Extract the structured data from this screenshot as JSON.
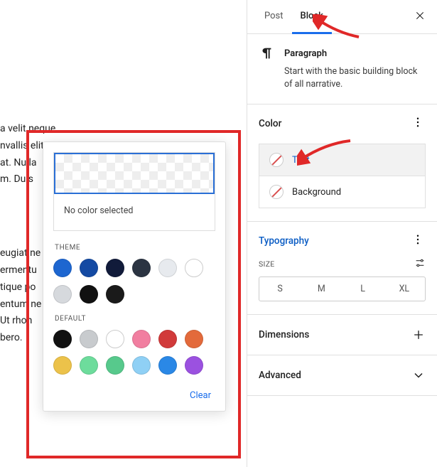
{
  "tabs": {
    "post": "Post",
    "block": "Block"
  },
  "block_intro": {
    "title": "Paragraph",
    "desc": "Start with the basic building block of all narrative."
  },
  "color_panel": {
    "title": "Color",
    "text_label": "Text",
    "background_label": "Background"
  },
  "typography_panel": {
    "title": "Typography",
    "size_label": "SIZE",
    "sizes": {
      "s": "S",
      "m": "M",
      "l": "L",
      "xl": "XL"
    }
  },
  "dimensions_label": "Dimensions",
  "advanced_label": "Advanced",
  "editor_text": {
    "p1_l1": "a velit neque,",
    "p1_l2": "nvallis elit viverra",
    "p1_l3": "at. Nulla",
    "p1_l4": "m. Duis",
    "p2_l1": "eugiat ne",
    "p2_l2": "ermentu",
    "p2_l3": "tique po",
    "p2_l4": "entum ne",
    "p2_l5": "Ut rhon",
    "p2_l6": "bero."
  },
  "popover": {
    "no_color": "No color selected",
    "theme_label": "THEME",
    "default_label": "DEFAULT",
    "clear": "Clear",
    "theme_colors": [
      "#1d66d0",
      "#144aa3",
      "#111b3a",
      "#2b3442",
      "#e7eaee",
      "#ffffff",
      "#d6d9dd",
      "#111111",
      "#1a1a1a"
    ],
    "default_colors": [
      "#111111",
      "#c8cbce",
      "#ffffff",
      "#f17ea0",
      "#d13a3a",
      "#e36a3b",
      "#ecc24a",
      "#6ddc9c",
      "#57c98c",
      "#8fd0f5",
      "#2a88e6",
      "#9b51e0"
    ]
  }
}
